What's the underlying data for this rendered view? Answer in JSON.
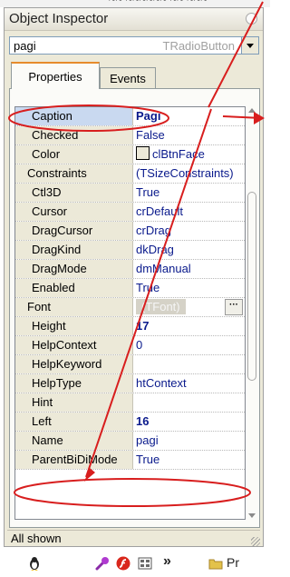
{
  "window": {
    "title": "Object Inspector"
  },
  "selector": {
    "component_name": "pagi",
    "component_type": "TRadioButton"
  },
  "tabs": [
    {
      "label": "Properties"
    },
    {
      "label": "Events"
    }
  ],
  "properties": [
    {
      "name": "Caption",
      "value": "Pagi"
    },
    {
      "name": "Checked",
      "value": "False"
    },
    {
      "name": "Color",
      "value": "clBtnFace"
    },
    {
      "name": "Constraints",
      "value": "(TSizeConstraints)"
    },
    {
      "name": "Ctl3D",
      "value": "True"
    },
    {
      "name": "Cursor",
      "value": "crDefault"
    },
    {
      "name": "DragCursor",
      "value": "crDrag"
    },
    {
      "name": "DragKind",
      "value": "dkDrag"
    },
    {
      "name": "DragMode",
      "value": "dmManual"
    },
    {
      "name": "Enabled",
      "value": "True"
    },
    {
      "name": "Font",
      "value": "(TFont)"
    },
    {
      "name": "Height",
      "value": "17"
    },
    {
      "name": "HelpContext",
      "value": "0"
    },
    {
      "name": "HelpKeyword",
      "value": ""
    },
    {
      "name": "HelpType",
      "value": "htContext"
    },
    {
      "name": "Hint",
      "value": ""
    },
    {
      "name": "Left",
      "value": "16"
    },
    {
      "name": "Name",
      "value": "pagi"
    },
    {
      "name": "ParentBiDiMode",
      "value": "True"
    }
  ],
  "status": {
    "text": "All shown"
  },
  "taskbar": {
    "chevron": "»",
    "label": "Pr"
  },
  "colors": {
    "annotation_red": "#d81e1e",
    "value_blue": "#0a1a8c",
    "tab_accent": "#e68b2c",
    "panel_bg": "#ece9d8"
  }
}
